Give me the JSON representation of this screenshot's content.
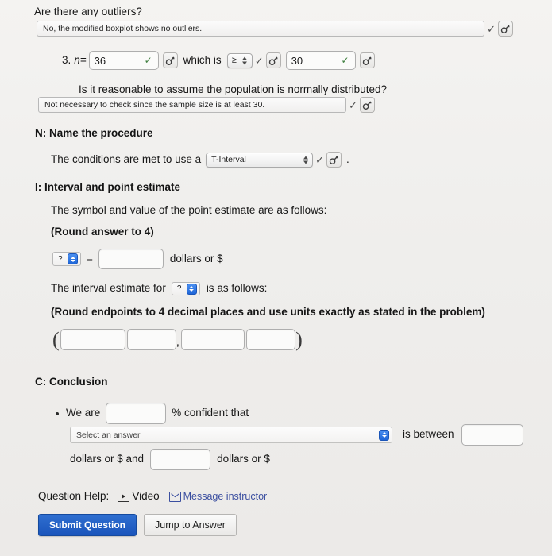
{
  "outliers": {
    "question": "Are there any outliers?",
    "answer_select": "No, the modified boxplot shows no outliers."
  },
  "step3": {
    "number": "3.",
    "label": "n=",
    "n_value": "36",
    "which_is": "which is",
    "comparison": "≥",
    "threshold_value": "30"
  },
  "normality": {
    "question": "Is it reasonable to assume the population is normally distributed?",
    "answer_select": "Not necessary to check since the sample size is at least 30."
  },
  "name_procedure": {
    "heading": "N: Name the procedure",
    "sentence_start": "The conditions are met to use a",
    "procedure_select": "T-Interval",
    "sentence_end": "."
  },
  "interval_point": {
    "heading": "I: Interval and point estimate",
    "line1": "The symbol and value of the point estimate are as follows:",
    "line2": "(Round answer to 4)",
    "symbol_placeholder": "?",
    "equals": "=",
    "point_value": "",
    "units": "dollars or $",
    "interval_line_start": "The interval estimate for",
    "interval_symbol_placeholder": "?",
    "interval_line_end": "is as follows:",
    "round_note": "(Round endpoints to 4 decimal places and use units exactly as stated in the problem)",
    "open_paren": "(",
    "comma": ",",
    "close_paren": ")",
    "box1": "",
    "box2": "",
    "box3": "",
    "box4": ""
  },
  "conclusion": {
    "heading": "C: Conclusion",
    "we_are": "We are",
    "confidence_value": "",
    "percent_confident": "% confident that",
    "answer_select_placeholder": "Select an answer",
    "is_between": "is between",
    "lower_value": "",
    "units_and": "dollars or $ and",
    "upper_value": "",
    "units_end": "dollars or $"
  },
  "help": {
    "label": "Question Help:",
    "video_label": "Video",
    "video_icon": "play-icon",
    "message_label": "Message instructor",
    "message_icon": "envelope-icon"
  },
  "actions": {
    "submit_label": "Submit Question",
    "jump_label": "Jump to Answer"
  },
  "icons": {
    "magnifier": "magnifier-icon",
    "check": "✓",
    "stepper": "stepper-icon"
  },
  "colors": {
    "accent_blue": "#1f66d8",
    "submit_blue": "#2f6fd0",
    "link": "#3b4fa0",
    "check_green": "#3c7d3c",
    "page_bg": "#f2f1ef"
  }
}
